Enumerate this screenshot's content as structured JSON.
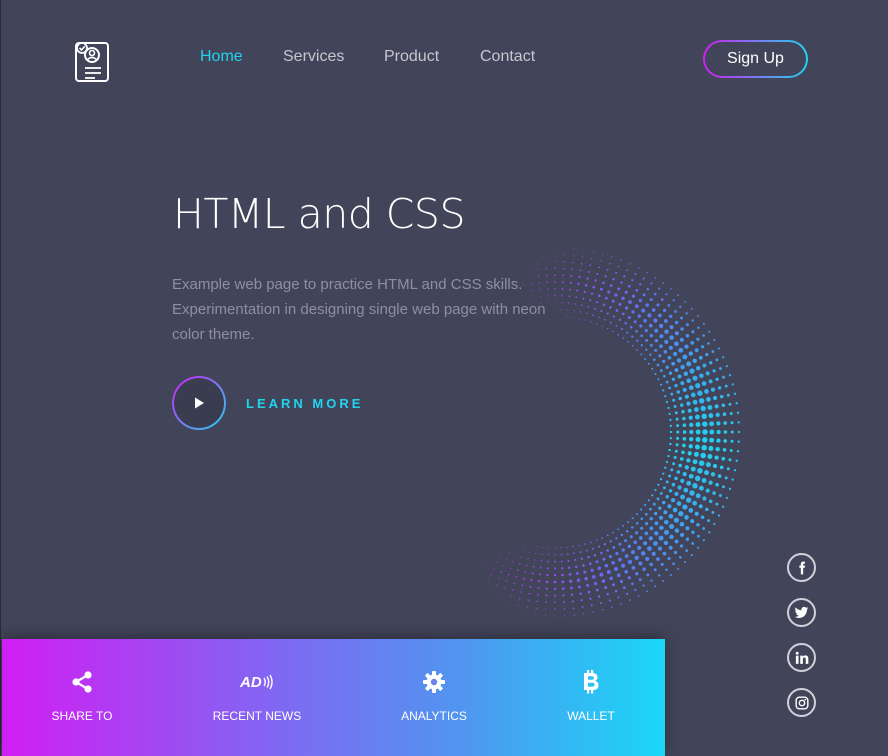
{
  "header": {
    "logo_icon": "id-badge-check-icon",
    "nav": [
      {
        "label": "Home",
        "active": true
      },
      {
        "label": "Services",
        "active": false
      },
      {
        "label": "Product",
        "active": false
      },
      {
        "label": "Contact",
        "active": false
      }
    ],
    "signup_label": "Sign Up"
  },
  "hero": {
    "title": "HTML and CSS",
    "description": "Example web page to practice HTML and CSS skills. Experimentation in designing single web page with neon color theme.",
    "learn_more": "LEARN MORE",
    "play_icon": "play-icon"
  },
  "social": [
    "facebook-icon",
    "twitter-icon",
    "linkedin-icon",
    "instagram-icon"
  ],
  "bottom_bar": [
    {
      "label": "SHARE TO",
      "icon": "share-icon"
    },
    {
      "label": "RECENT NEWS",
      "icon": "ad-audio-icon"
    },
    {
      "label": "ANALYTICS",
      "icon": "gear-icon"
    },
    {
      "label": "WALLET",
      "icon": "bitcoin-icon"
    }
  ],
  "colors": {
    "background": "#424459",
    "accent_cyan": "#22d3ee",
    "accent_magenta": "#d01ff2",
    "gradient_start": "#d21ef3",
    "gradient_end": "#1ad7f6"
  }
}
